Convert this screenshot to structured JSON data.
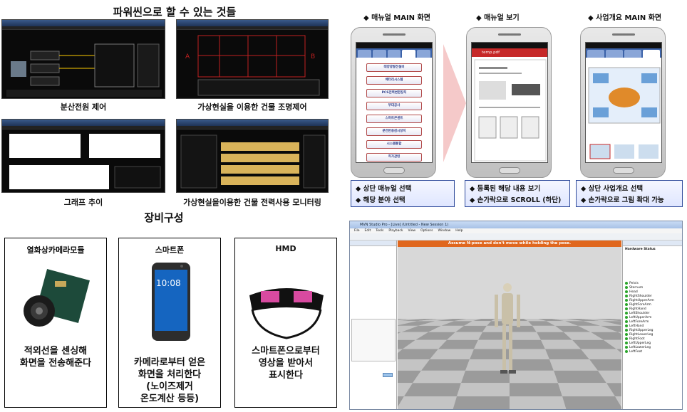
{
  "left_title": "파워씬으로 할 수 있는 것들",
  "screens": [
    {
      "caption": "분산전원 제어"
    },
    {
      "caption": "가상현실을 이용한 건물 조명제어"
    },
    {
      "caption": "그래프 추이"
    },
    {
      "caption": "가상현실을이용한 건물 전력사용 모니터링"
    }
  ],
  "equipment_title": "장비구성",
  "equipment": [
    {
      "title": "열화상카메라모듈",
      "desc_lines": [
        "적외선을 센싱해",
        "화면을 전송해준다"
      ]
    },
    {
      "title": "스마트폰",
      "desc_lines": [
        "카메라로부터 얻은",
        "화면을 처리한다",
        "(노이즈제거",
        "온도계산 등등)"
      ]
    },
    {
      "title": "HMD",
      "desc_lines": [
        "스마트폰으로부터",
        "영상을 받아서",
        "표시한다"
      ]
    }
  ],
  "phone_sections": [
    {
      "label": "◆ 매뉴얼 MAIN 화면"
    },
    {
      "label": "◆ 매뉴얼 보기"
    },
    {
      "label": "◆ 사업개요 MAIN 화면"
    }
  ],
  "manual_menu": [
    "태양광발전설비",
    "배터리시스템",
    "PCS전력변환장치",
    "부대공사",
    "스마트콘센트",
    "분전반용감시장치",
    "시스템통합",
    "허가관련"
  ],
  "pdf_filename": "temp.pdf",
  "notes": [
    {
      "lines": [
        "◆ 상단 매뉴얼 선택",
        "◆ 해당 분야 선택"
      ]
    },
    {
      "lines": [
        "◆ 등록된 해당 내용 보기",
        "◆ 손가락으로 SCROLL (하단)"
      ]
    },
    {
      "lines": [
        "◆ 상단 사업개요 선택",
        "◆ 손가락으로 그림 확대 가능"
      ]
    }
  ],
  "phone_clock": "10:08",
  "mvn": {
    "title": "MVN Studio Pro - [Live] (Untitled - New Session 1)",
    "menu": [
      "File",
      "Edit",
      "Tools",
      "Playback",
      "View",
      "Options",
      "Window",
      "Help"
    ],
    "alert": "Assume N-pose and don't move while holding the pose.",
    "right_header": "Hardware Status",
    "segments": [
      "Pelvis",
      "Sternum",
      "Head",
      "RightShoulder",
      "RightUpperArm",
      "RightForeArm",
      "RightHand",
      "LeftShoulder",
      "LeftUpperArm",
      "LeftForeArm",
      "LeftHand",
      "RightUpperLeg",
      "RightLowerLeg",
      "RightFoot",
      "LeftUpperLeg",
      "LeftLowerLeg",
      "LeftFoot"
    ]
  },
  "colors": {
    "accent_blue": "#2e4a9a",
    "alert_orange": "#e0671e",
    "menu_border": "#b24a4a"
  }
}
